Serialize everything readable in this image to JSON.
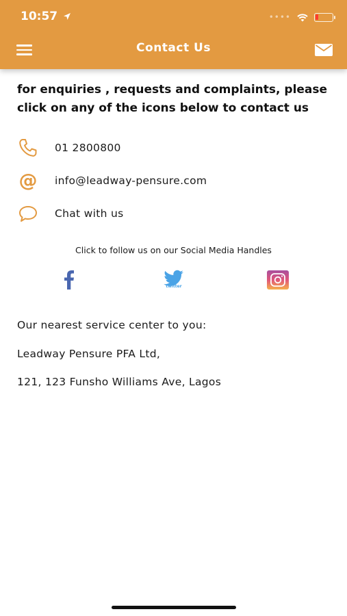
{
  "status_bar": {
    "time": "10:57"
  },
  "nav": {
    "title": "Contact Us"
  },
  "intro": {
    "text": "for enquiries , requests and complaints, please click on any of the icons below to contact us"
  },
  "contacts": [
    {
      "icon": "phone-icon",
      "label": "01 2800800"
    },
    {
      "icon": "at-icon",
      "glyph": "@",
      "label": "info@leadway-pensure.com"
    },
    {
      "icon": "chat-icon",
      "label": "Chat with us"
    }
  ],
  "social": {
    "caption": "Click to follow us on our Social Media Handles",
    "items": [
      {
        "icon": "facebook-icon",
        "color": "#4a67b0"
      },
      {
        "icon": "twitter-icon",
        "color": "#4aa3e6",
        "wordmark": "twitter"
      },
      {
        "icon": "instagram-icon",
        "color": "#c13584"
      }
    ]
  },
  "service_center": {
    "heading": "Our nearest service center to you:",
    "name": "Leadway Pensure PFA Ltd,",
    "address": "121, 123 Funsho Williams Ave, Lagos"
  },
  "colors": {
    "accent": "#e39a41",
    "text": "#1a1a1a"
  }
}
